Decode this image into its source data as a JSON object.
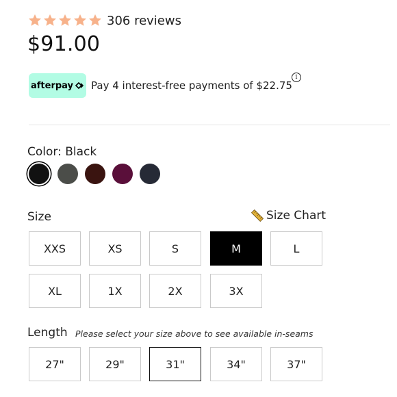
{
  "rating": {
    "stars": 5,
    "star_color": "#f7b28b",
    "count_text": "306 reviews"
  },
  "price": "$91.00",
  "afterpay": {
    "logo_text": "afterpay",
    "badge_color": "#b2fce4",
    "text": "Pay 4 interest-free payments of $22.75",
    "info_icon": "info-icon"
  },
  "color": {
    "label": "Color: Black",
    "swatches": [
      {
        "name": "Black",
        "hex": "#111111",
        "selected": true
      },
      {
        "name": "Charcoal",
        "hex": "#4b4d49",
        "selected": false
      },
      {
        "name": "Brown",
        "hex": "#3a1410",
        "selected": false
      },
      {
        "name": "Plum",
        "hex": "#5a0f3a",
        "selected": false
      },
      {
        "name": "Navy",
        "hex": "#262a36",
        "selected": false
      }
    ]
  },
  "size": {
    "label": "Size",
    "chart_label": "Size Chart",
    "chart_icon": "ruler-icon",
    "options": [
      "XXS",
      "XS",
      "S",
      "M",
      "L",
      "XL",
      "1X",
      "2X",
      "3X"
    ],
    "selected": "M"
  },
  "length": {
    "label": "Length",
    "note": "Please select your size above to see available in-seams",
    "options": [
      "27\"",
      "29\"",
      "31\"",
      "34\"",
      "37\""
    ],
    "outlined": "31\""
  }
}
